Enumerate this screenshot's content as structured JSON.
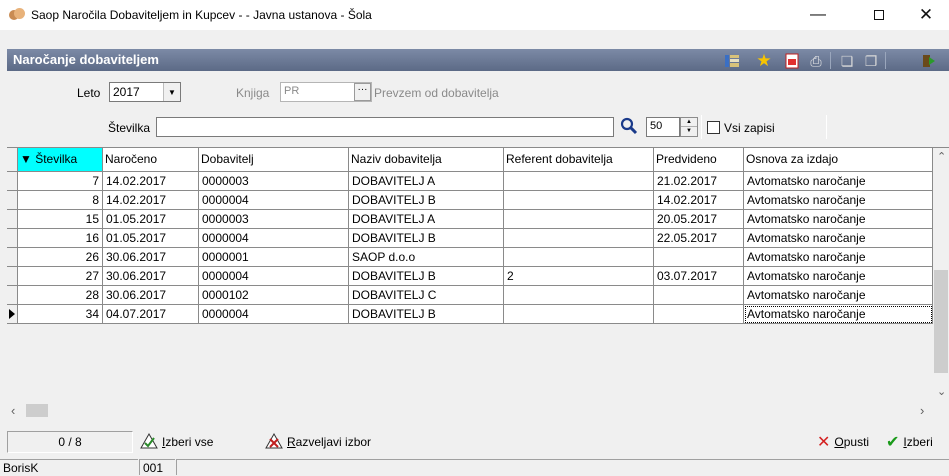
{
  "window": {
    "title": "Saop Naročila Dobaviteljem in Kupcev -  - Javna ustanova - Šola"
  },
  "form": {
    "title": "Naročanje dobaviteljem"
  },
  "filters": {
    "leto_label": "Leto",
    "leto_value": "2017",
    "knjiga_label": "Knjiga",
    "knjiga_value": "PR",
    "knjiga_description": "Prevzem od dobavitelja",
    "stevilka_label": "Številka",
    "stevilka_value": "",
    "limit_value": "50",
    "vsi_zapisi_label": "Vsi zapisi",
    "vsi_zapisi_checked": false
  },
  "grid": {
    "columns": [
      "▼ Številka",
      "Naročeno",
      "Dobavitelj",
      "Naziv dobavitelja",
      "Referent dobavitelja",
      "Predvideno",
      "Osnova za izdajo"
    ],
    "rows": [
      [
        "7",
        "14.02.2017",
        "0000003",
        "DOBAVITELJ  A",
        "",
        "21.02.2017",
        "Avtomatsko naročanje"
      ],
      [
        "8",
        "14.02.2017",
        "0000004",
        "DOBAVITELJ  B",
        "",
        "14.02.2017",
        "Avtomatsko naročanje"
      ],
      [
        "15",
        "01.05.2017",
        "0000003",
        "DOBAVITELJ  A",
        "",
        "20.05.2017",
        "Avtomatsko naročanje"
      ],
      [
        "16",
        "01.05.2017",
        "0000004",
        "DOBAVITELJ  B",
        "",
        "22.05.2017",
        "Avtomatsko naročanje"
      ],
      [
        "26",
        "30.06.2017",
        "0000001",
        "SAOP d.o.o",
        "",
        "",
        "Avtomatsko naročanje"
      ],
      [
        "27",
        "30.06.2017",
        "0000004",
        "DOBAVITELJ  B",
        "2",
        "03.07.2017",
        "Avtomatsko naročanje"
      ],
      [
        "28",
        "30.06.2017",
        "0000102",
        "DOBAVITELJ C",
        "",
        "",
        "Avtomatsko naročanje"
      ],
      [
        "34",
        "04.07.2017",
        "0000004",
        "DOBAVITELJ  B",
        "",
        "",
        "Avtomatsko naročanje"
      ]
    ],
    "current_row_index": 7
  },
  "bottom": {
    "counter": "0 / 8",
    "select_all_label": "Izberi vse",
    "deselect_label": "Razveljavi izbor",
    "cancel_label": "Opusti",
    "confirm_label": "Izberi"
  },
  "status": {
    "user": "BorisK",
    "code": "001"
  },
  "colors": {
    "header_bar": "#6b7895",
    "sorted_column": "#00ffff",
    "cancel_icon": "#d42020",
    "confirm_icon": "#1a9a1a"
  }
}
